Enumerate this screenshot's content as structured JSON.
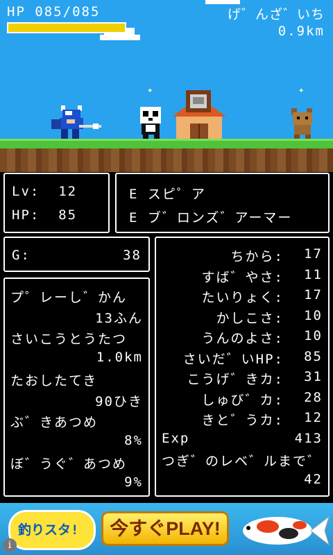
{
  "hud": {
    "hp_text": "HP 085/085",
    "hp_fraction": 1.0,
    "location": "げ゛んざ゛いち",
    "distance": "0.9km"
  },
  "equipment": {
    "lv": "Lv:  12",
    "hp": "HP:  85",
    "weapon": "E スピ゜ア",
    "armor": "E ブ゛ロンズ゛アーマー"
  },
  "gold": {
    "label": "G:",
    "value": "38"
  },
  "records": [
    {
      "label": "プ゜レーし゛かん",
      "value": "13ふん"
    },
    {
      "label": "さいこうとうたつ",
      "value": "1.0km"
    },
    {
      "label": "たおしたてき",
      "value": "90ひき"
    },
    {
      "label": "ぶ゛きあつめ",
      "value": "8%"
    },
    {
      "label": "ぼ゛うぐ゛あつめ",
      "value": "9%"
    }
  ],
  "stats": [
    {
      "label": "ちから:",
      "value": "17"
    },
    {
      "label": "すば゛やさ:",
      "value": "11"
    },
    {
      "label": "たいりょく:",
      "value": "17"
    },
    {
      "label": "かしこさ:",
      "value": "10"
    },
    {
      "label": "うんのよさ:",
      "value": "10"
    },
    {
      "label": "さいだ゛いHP:",
      "value": "85"
    },
    {
      "label": "こうげ゛きカ:",
      "value": "31"
    },
    {
      "label": "しゅび゛カ:",
      "value": "28"
    },
    {
      "label": "きと゛うカ:",
      "value": "12"
    },
    {
      "label": "Exp",
      "value": "413"
    }
  ],
  "next_level": {
    "label": "つぎ゛のレベ゛ルまで゛",
    "value": "42"
  },
  "ad": {
    "logo_text": "釣りスタ!",
    "button_label": "今すぐPLAY!"
  },
  "icons": {
    "info": "info-icon",
    "sparkle": "sparkle-icon"
  },
  "colors": {
    "sky": "#2aa3ee",
    "hp_bar": "#f0d000",
    "grass": "#4fc43a"
  }
}
